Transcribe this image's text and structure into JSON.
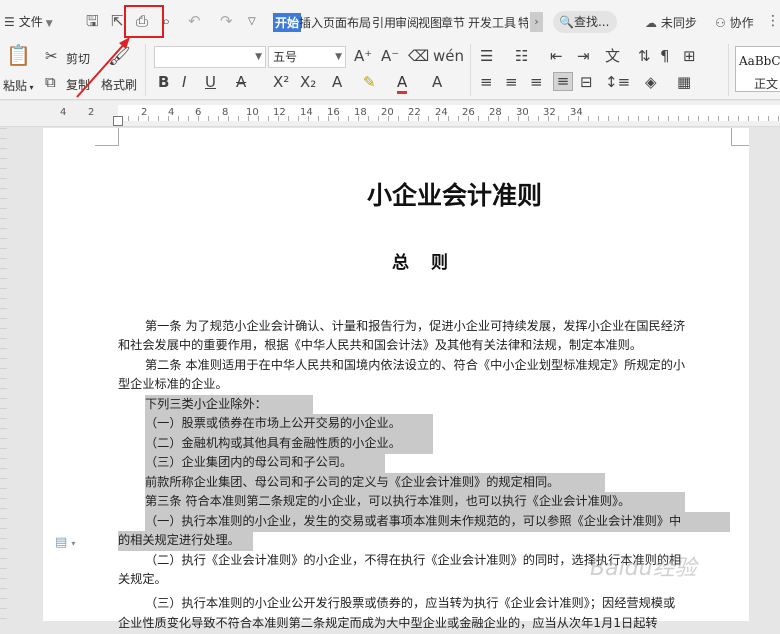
{
  "topbar": {
    "file_menu": "文件",
    "tabs": [
      "开始",
      "插入",
      "页面布局",
      "引用",
      "审阅",
      "视图",
      "章节",
      "开发工具",
      "特"
    ],
    "search_label": "查找...",
    "sync_label": "未同步",
    "collab_label": "协作"
  },
  "ribbon": {
    "paste_label": "粘贴",
    "cut_label": "剪切",
    "copy_label": "复制",
    "format_painter_label": "格式刷",
    "font_size_value": "五号",
    "style_sample": "AaBbCcDd",
    "style_name": "正文"
  },
  "ruler": {
    "numbers": [
      "4",
      "2",
      "2",
      "4",
      "6",
      "8",
      "10",
      "12",
      "14",
      "16",
      "18",
      "20",
      "22",
      "24",
      "26",
      "28",
      "30",
      "32",
      "34"
    ]
  },
  "document": {
    "title": "小企业会计准则",
    "subtitle": "总 则",
    "paragraphs": [
      "第一条  为了规范小企业会计确认、计量和报告行为，促进小企业可持续发展，发挥小企业在国民经济",
      "和社会发展中的重要作用，根据《中华人民共和国会计法》及其他有关法律和法规，制定本准则。",
      "第二条  本准则适用于在中华人民共和国境内依法设立的、符合《中小企业划型标准规定》所规定的小",
      "型企业标准的企业。",
      "下列三类小企业除外：",
      "（一）股票或债券在市场上公开交易的小企业。",
      "（二）金融机构或其他具有金融性质的小企业。",
      "（三）企业集团内的母公司和子公司。",
      "前款所称企业集团、母公司和子公司的定义与《企业会计准则》的规定相同。",
      "第三条  符合本准则第二条规定的小企业，可以执行本准则，也可以执行《企业会计准则》。",
      "（一）执行本准则的小企业，发生的交易或者事项本准则未作规范的，可以参照《企业会计准则》中",
      "的相关规定进行处理。",
      "（二）执行《企业会计准则》的小企业，不得在执行《企业会计准则》的同时，选择执行本准则的相",
      "关规定。",
      "（三）执行本准则的小企业公开发行股票或债券的，应当转为执行《企业会计准则》；因经营规模或",
      "企业性质变化导致不符合本准则第二条规定而成为大中型企业或金融企业的，应当从次年1月1日起转"
    ]
  },
  "watermark": "Baidu经验"
}
